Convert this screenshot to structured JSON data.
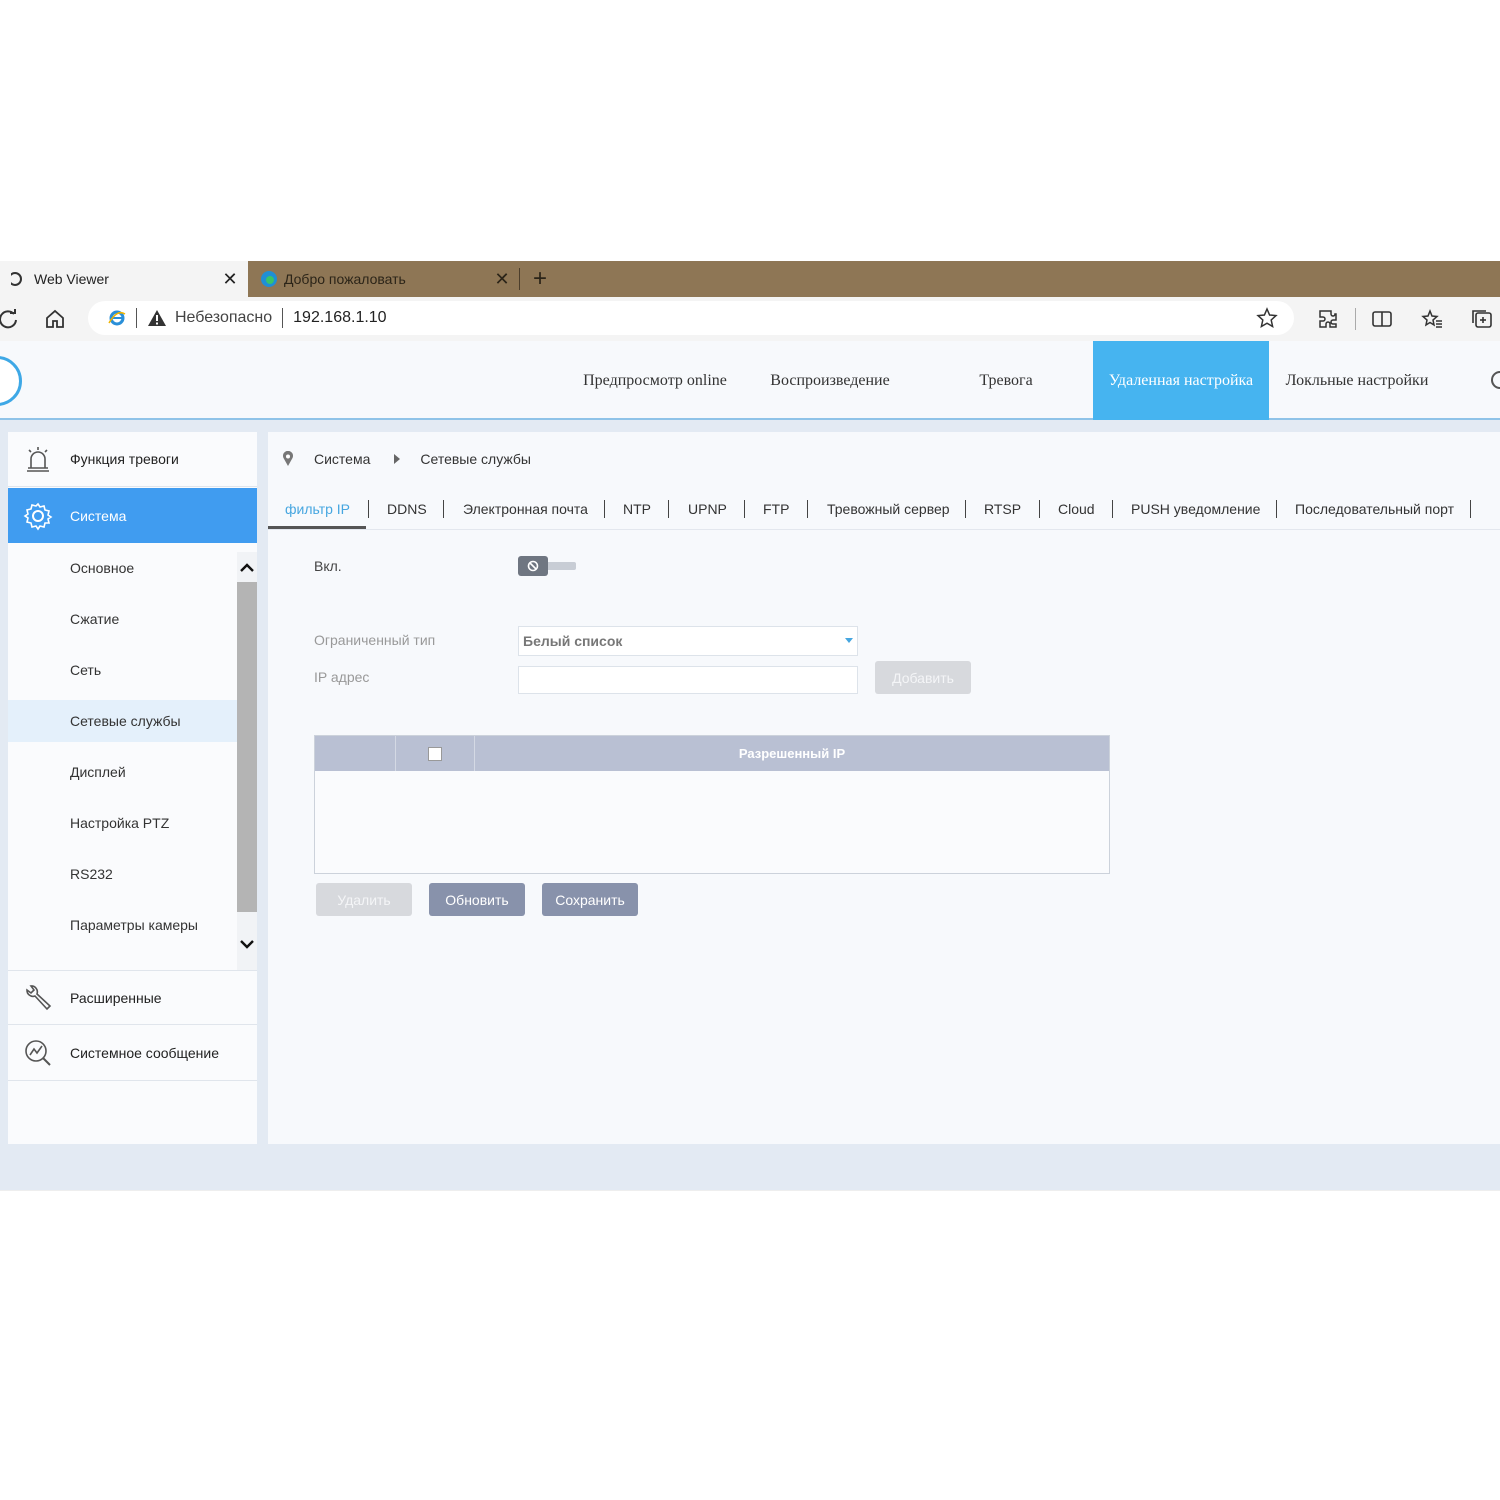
{
  "browser": {
    "tabs": [
      {
        "title": "Web Viewer",
        "active": true
      },
      {
        "title": "Добро пожаловать",
        "active": false
      }
    ],
    "security_label": "Небезопасно",
    "url": "192.168.1.10",
    "colors": {
      "tabbar": "#8e7655",
      "chrome": "#f4f4f4"
    }
  },
  "header": {
    "nav": [
      {
        "label": "Предпросмотр online"
      },
      {
        "label": "Воспроизведение"
      },
      {
        "label": "Тревога"
      },
      {
        "label": "Удаленная настройка",
        "active": true
      },
      {
        "label": "Локльные настройки"
      }
    ],
    "accent": "#46b4f0"
  },
  "sidebar": {
    "main": [
      {
        "label": "Функция тревоги",
        "icon": "alarm-light-icon"
      },
      {
        "label": "Система",
        "icon": "gear-icon",
        "active": true
      },
      {
        "label": "Расширенные",
        "icon": "wrench-icon"
      },
      {
        "label": "Системное сообщение",
        "icon": "chart-search-icon"
      }
    ],
    "sub": [
      {
        "label": "Основное"
      },
      {
        "label": "Сжатие"
      },
      {
        "label": "Сеть"
      },
      {
        "label": "Сетевые службы",
        "active": true
      },
      {
        "label": "Дисплей"
      },
      {
        "label": "Настройка PTZ"
      },
      {
        "label": "RS232"
      },
      {
        "label": "Параметры камеры"
      }
    ]
  },
  "breadcrumb": {
    "root": "Система",
    "current": "Сетевые службы"
  },
  "subtabs": [
    {
      "label": "фильтр IP",
      "active": true
    },
    {
      "label": "DDNS"
    },
    {
      "label": "Электронная почта"
    },
    {
      "label": "NTP"
    },
    {
      "label": "UPNP"
    },
    {
      "label": "FTP"
    },
    {
      "label": "Тревожный сервер"
    },
    {
      "label": "RTSP"
    },
    {
      "label": "Cloud"
    },
    {
      "label": "PUSH уведомление"
    },
    {
      "label": "Последовательный порт"
    }
  ],
  "form": {
    "enable_label": "Вкл.",
    "enabled": false,
    "type_label": "Ограниченный тип",
    "type_value": "Белый список",
    "ip_label": "IP адрес",
    "ip_value": "",
    "add_button": "Добавить"
  },
  "table": {
    "header": "Разрешенный IP",
    "rows": []
  },
  "actions": {
    "delete": "Удалить",
    "refresh": "Обновить",
    "save": "Сохранить"
  }
}
